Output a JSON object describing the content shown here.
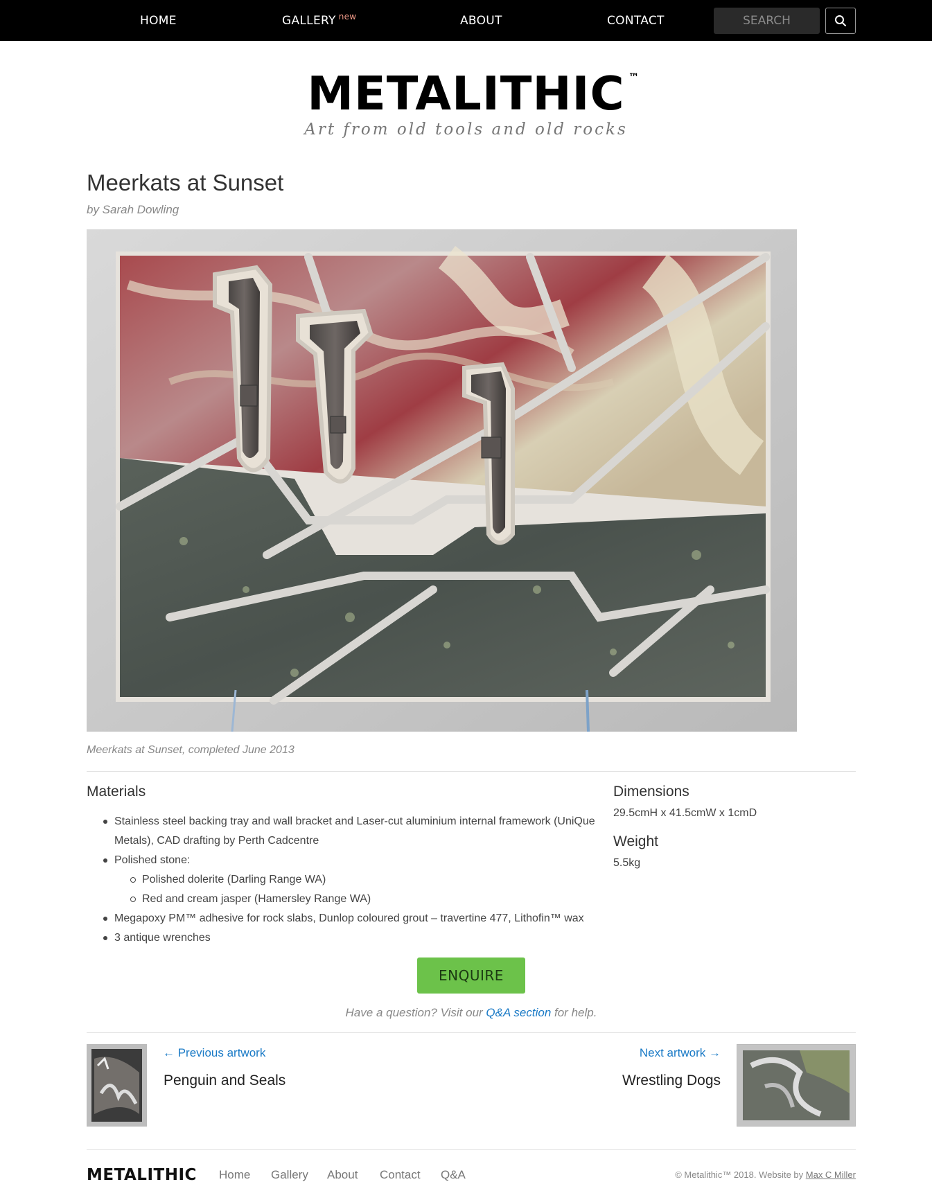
{
  "nav": {
    "items": [
      {
        "label": "HOME"
      },
      {
        "label": "GALLERY",
        "badge": "new"
      },
      {
        "label": "ABOUT"
      },
      {
        "label": "CONTACT"
      }
    ],
    "search_placeholder": "SEARCH",
    "search_icon": "search-icon"
  },
  "brand": {
    "name": "METALITHIC",
    "tm": "™",
    "tagline": "Art from old tools and old rocks"
  },
  "artwork": {
    "title": "Meerkats at Sunset",
    "byline": "by Sarah Dowling",
    "caption": "Meerkats at Sunset, completed June 2013"
  },
  "materials": {
    "heading": "Materials",
    "items": [
      "Stainless steel backing tray and wall bracket and Laser-cut aluminium internal framework (UniQue Metals), CAD drafting by Perth Cadcentre",
      "Polished stone:",
      "Megapoxy PM™ adhesive for rock slabs, Dunlop coloured grout – travertine 477, Lithofin™ wax",
      "3 antique wrenches"
    ],
    "stone_items": [
      "Polished dolerite (Darling Range WA)",
      "Red and cream jasper (Hamersley Range WA)"
    ]
  },
  "dimensions": {
    "heading": "Dimensions",
    "value": "29.5cmH x 41.5cmW x 1cmD"
  },
  "weight": {
    "heading": "Weight",
    "value": "5.5kg"
  },
  "enquire_label": "ENQUIRE",
  "help": {
    "before": "Have a question? Visit our ",
    "link": "Q&A section",
    "after": " for help."
  },
  "prev": {
    "label": "← Previous artwork",
    "title": "Penguin and Seals"
  },
  "next": {
    "label": "Next artwork →",
    "title": "Wrestling Dogs"
  },
  "footer": {
    "logo": "METALITHIC",
    "links": [
      "Home",
      "Gallery",
      "About",
      "Contact",
      "Q&A"
    ],
    "copyright": "© Metalithic™ 2018. Website by ",
    "author": "Max C Miller"
  },
  "colors": {
    "nav_bg": "#000000",
    "accent_green": "#6cc24a",
    "link_blue": "#1a7ac6",
    "new_badge": "#f39c8a"
  }
}
